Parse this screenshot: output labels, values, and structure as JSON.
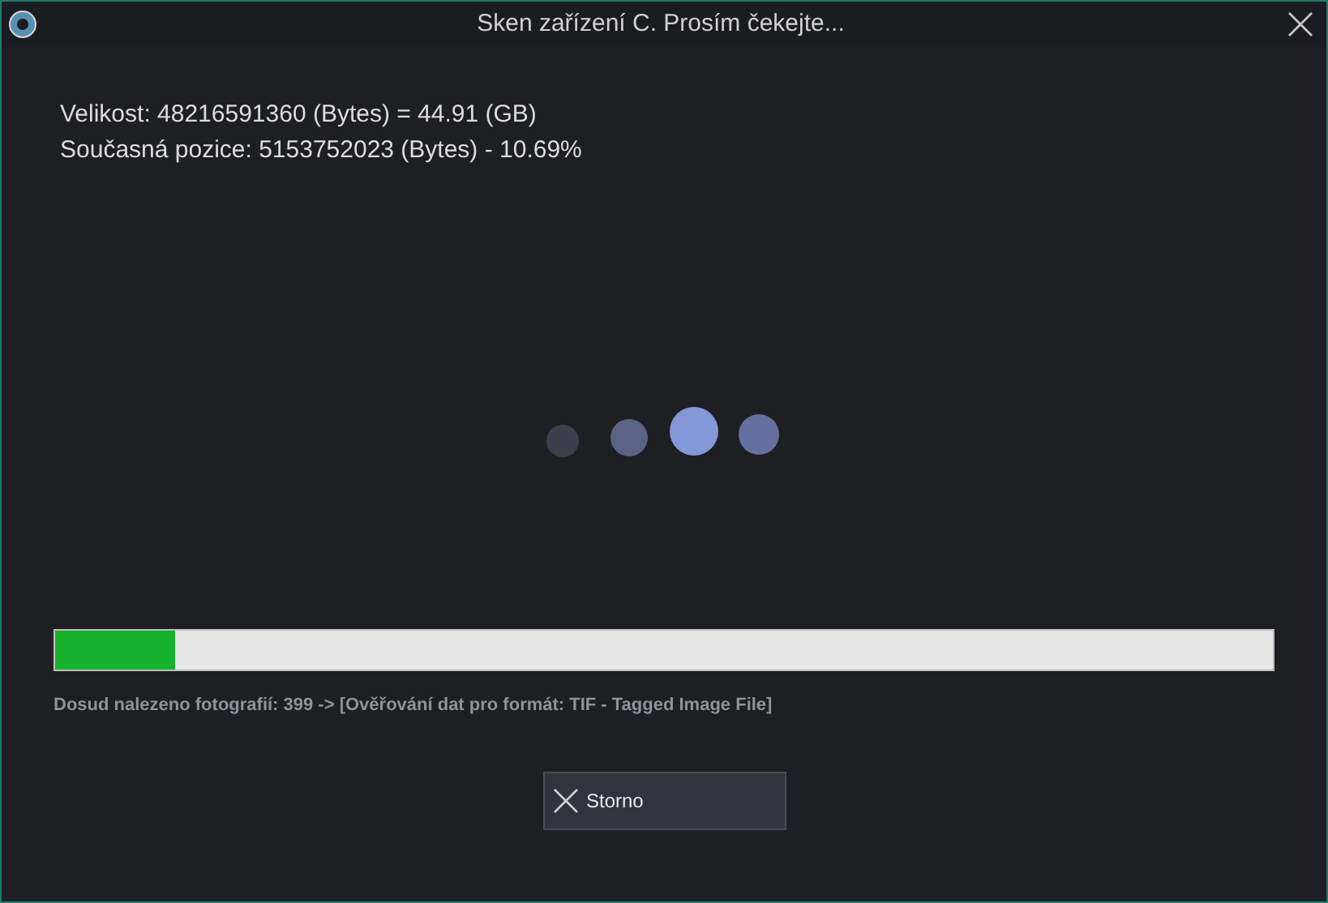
{
  "window": {
    "title": "Sken zařízení C. Prosím čekejte..."
  },
  "info_lines": [
    "Velikost: 48216591360 (Bytes) = 44.91 (GB)",
    "Současná pozice: 5153752023 (Bytes) - 10.69%"
  ],
  "progress": {
    "level": 0.098
  },
  "status": "Dosud nalezeno fotografií: 399 -> [Ověřování dat pro formát: TIF - Tagged Image File]",
  "buttons": [
    {
      "label": "Storno",
      "kind": "cancel"
    }
  ]
}
